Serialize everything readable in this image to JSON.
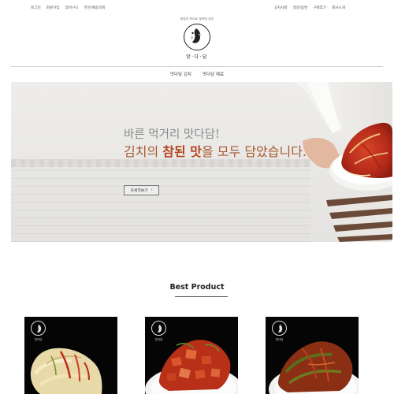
{
  "util_left": [
    "로그인",
    "회원가입",
    "장바구니",
    "주문/배송조회"
  ],
  "util_right": [
    "공지사항",
    "질문/답변",
    "구매후기",
    "회사소개"
  ],
  "logo": {
    "slogan": "정성과 맛으로 빚어낸 김치",
    "name": "맛·다·담"
  },
  "nav": [
    "맛다담 김치",
    "맛다담 재료"
  ],
  "hero": {
    "line1": "바른 먹거리 맛다담!",
    "line2_pre": "김치의 ",
    "line2_em": "참된 맛",
    "line2_post": "을 모두 담았습니다.",
    "button_label": "자세히보기",
    "button_arrow": "›"
  },
  "best": {
    "title": "Best Product"
  },
  "products": [
    {
      "kind": "baechu-kimchi",
      "brand": "맛다담"
    },
    {
      "kind": "kkakdugi",
      "brand": "맛다담"
    },
    {
      "kind": "yeolmu-kimchi",
      "brand": "맛다담"
    }
  ],
  "colors": {
    "accent": "#b4451e",
    "hero_sub": "#a65a2c",
    "divider": "#cfcfcf"
  }
}
